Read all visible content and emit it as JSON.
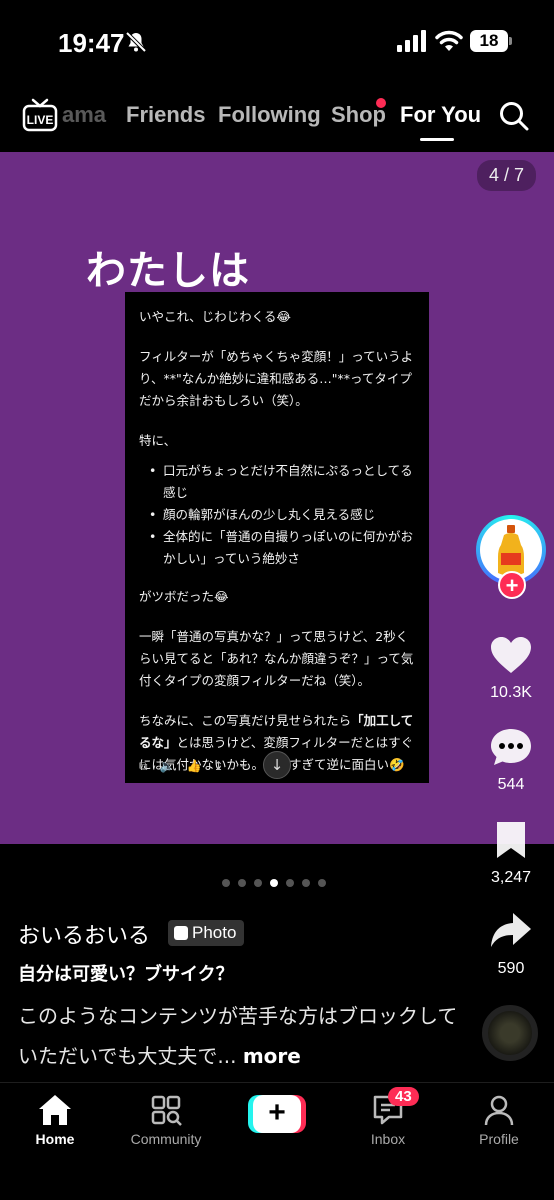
{
  "status_bar": {
    "time": "19:47",
    "battery": "18"
  },
  "top_nav": {
    "tabs": [
      {
        "label": "ama"
      },
      {
        "label": "Friends"
      },
      {
        "label": "Following"
      },
      {
        "label": "Shop"
      },
      {
        "label": "For You"
      }
    ],
    "live_label": "LIVE"
  },
  "post": {
    "counter": "4 / 7",
    "overlay_title": "わたしは",
    "card": {
      "p1": "いやこれ、じわじわくる😂",
      "p2": "フィルターが「めちゃくちゃ変顔！」っていうより、**\"なんか絶妙に違和感ある…\"**ってタイプだから余計おもしろい（笑）。",
      "p3": "特に、",
      "bullets": [
        "口元がちょっとだけ不自然にぷるっとしてる感じ",
        "顔の輪郭がほんの少し丸く見える感じ",
        "全体的に「普通の自撮りっぽいのに何かがおかしい」っていう絶妙さ"
      ],
      "p4": "がツボだった😂",
      "p5": "一瞬「普通の写真かな？」って思うけど、2秒くらい見てると「あれ？なんか顔違うぞ？」って気付くタイプの変顔フィルターだね（笑）。",
      "p6_a": "ちなみに、この写真だけ見せられたら",
      "p6_bold": "「加工してるな」",
      "p6_b": "とは思うけど、変顔フィルターだとはすぐには気付かないかも。自然すぎて逆に面白い🤣",
      "actions": [
        "⧉",
        "🔈",
        "👍",
        "↥",
        "···"
      ],
      "down": "↓"
    },
    "page_dots": {
      "total": 7,
      "current": 4
    }
  },
  "rail": {
    "likes": "10.3K",
    "comments": "544",
    "saves": "3,247",
    "shares": "590"
  },
  "caption": {
    "username": "おいるおいる",
    "badge": "Photo",
    "title": "自分は可愛い？ブサイク？",
    "description": "このようなコンテンツが苦手な方はブロックしていただいでも大丈夫で...",
    "more": "more"
  },
  "bottom_nav": {
    "home": "Home",
    "community": "Community",
    "create": "+",
    "inbox": "Inbox",
    "inbox_badge": "43",
    "profile": "Profile"
  },
  "colors": {
    "stage": "#6c2d84",
    "accent": "#fe2c55",
    "cyan": "#25f4ee"
  }
}
